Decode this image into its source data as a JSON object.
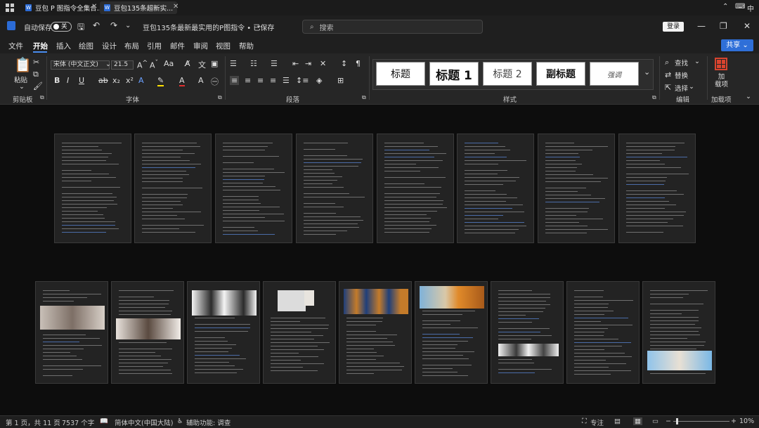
{
  "taskbar": {
    "tabs": [
      {
        "label": "豆包 P 图指令全集合..."
      },
      {
        "label": "豆包135条超新实..."
      }
    ],
    "tray_ime": "中"
  },
  "titlebar": {
    "autosave_label": "自动保存",
    "autosave_state": "关",
    "doc_title": "豆包135条最新最实用的P图指令 • 已保存",
    "search_placeholder": "搜索",
    "login_label": "登录"
  },
  "menu": [
    "文件",
    "开始",
    "插入",
    "绘图",
    "设计",
    "布局",
    "引用",
    "邮件",
    "审阅",
    "视图",
    "帮助"
  ],
  "share_label": "共享",
  "ribbon": {
    "clipboard": {
      "paste_label": "粘贴",
      "group_label": "剪贴板"
    },
    "font": {
      "font_name": "宋体 (中文正文)",
      "font_size": "21.5",
      "group_label": "字体"
    },
    "paragraph": {
      "group_label": "段落"
    },
    "styles": {
      "items": [
        "标题",
        "标题 1",
        "标题 2",
        "副标题",
        "强调"
      ],
      "group_label": "样式"
    },
    "editing": {
      "find": "查找",
      "replace": "替换",
      "select": "选择",
      "group_label": "编辑"
    },
    "addins": {
      "button_label": "加\n载项",
      "group_label": "加载项"
    }
  },
  "status": {
    "page": "第 1 页，共 11 页",
    "words": "7537 个字",
    "language": "简体中文(中国大陆)",
    "accessibility": "辅助功能: 调查",
    "focus": "专注",
    "zoom": "10%"
  },
  "colors": {
    "accent": "#2f6fd8",
    "background": "#0d0d0d",
    "page": "#232323"
  }
}
